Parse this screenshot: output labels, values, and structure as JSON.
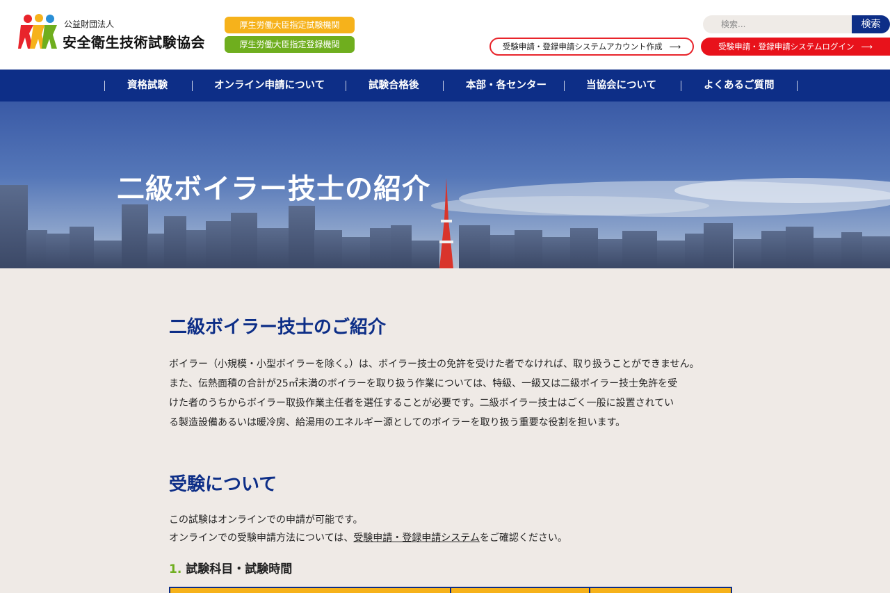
{
  "header": {
    "org_small": "公益財団法人",
    "org_name": "安全衛生技術試験協会",
    "badges": [
      "厚生労働大臣指定試験機関",
      "厚生労働大臣指定登録機関"
    ],
    "search": {
      "placeholder": "検索...",
      "button": "検索"
    },
    "account_button": "受験申請・登録申請システムアカウント作成",
    "login_button": "受験申請・登録申請システムログイン",
    "arrow": "⟶"
  },
  "nav": {
    "items": [
      "資格試験",
      "オンライン申請について",
      "試験合格後",
      "本部・各センター",
      "当協会について",
      "よくあるご質問"
    ]
  },
  "hero": {
    "title": "二級ボイラー技士の紹介"
  },
  "main": {
    "intro_heading": "二級ボイラー技士のご紹介",
    "intro_lines": [
      "ボイラー（小規模・小型ボイラーを除く。）は、ボイラー技士の免許を受けた者でなければ、取り扱うことができません。",
      "また、伝熱面積の合計が25㎡未満のボイラーを取り扱う作業については、特級、一級又は二級ボイラー技士免許を受",
      "けた者のうちからボイラー取扱作業主任者を選任することが必要です。二級ボイラー技士はごく一般に設置されてい",
      "る製造設備あるいは暖冷房、給湯用のエネルギー源としてのボイラーを取り扱う重要な役割を担います。"
    ],
    "exam_heading": "受験について",
    "exam_line1": "この試験はオンラインでの申請が可能です。",
    "exam_line2_pre": "オンラインでの受験申請方法については、",
    "exam_line2_link": "受験申請・登録申請システム",
    "exam_line2_post": "をご確認ください。",
    "section1_num": "1.",
    "section1_title": "試験科目・試験時間"
  },
  "colors": {
    "navy": "#0d2e87",
    "red": "#e8121b",
    "orange": "#f6b21b",
    "green": "#6fae1e",
    "bg": "#efeae6"
  }
}
